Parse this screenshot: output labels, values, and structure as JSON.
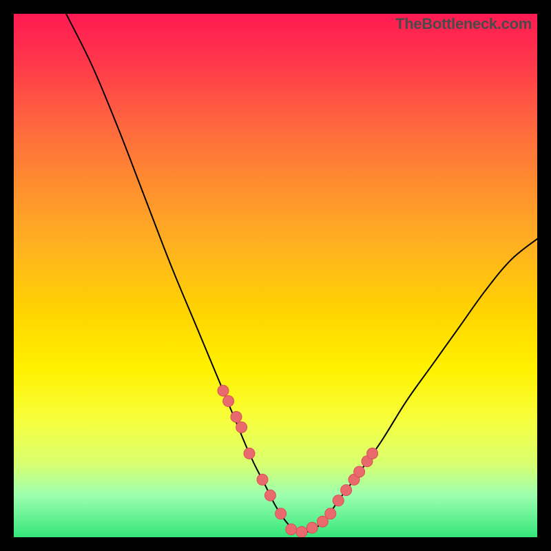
{
  "watermark": "TheBottleneck.com",
  "colors": {
    "curve": "#000000",
    "marker_fill": "#e86a6d",
    "marker_stroke": "#d95057"
  },
  "chart_data": {
    "type": "line",
    "title": "",
    "xlabel": "",
    "ylabel": "",
    "xlim": [
      0,
      100
    ],
    "ylim": [
      0,
      100
    ],
    "note": "Axes have no visible tick labels; x and y normalized 0–100. y represents bottleneck mismatch percentage (lower = better). Curve is V-shaped with minimum near x≈55.",
    "series": [
      {
        "name": "bottleneck-curve",
        "x": [
          10,
          15,
          20,
          25,
          30,
          35,
          40,
          45,
          48,
          50,
          52,
          54,
          56,
          58,
          60,
          62,
          65,
          70,
          75,
          80,
          85,
          90,
          95,
          100
        ],
        "y": [
          100,
          90,
          78,
          65,
          52,
          40,
          28,
          16,
          10,
          6,
          3,
          1,
          1,
          2,
          4,
          7,
          11,
          18,
          26,
          33,
          40,
          47,
          53,
          57
        ]
      }
    ],
    "markers": {
      "name": "highlighted-points",
      "x": [
        40,
        41,
        42.5,
        43.5,
        45,
        47.5,
        49,
        51,
        53,
        55,
        57,
        59,
        60.5,
        62,
        63.5,
        65,
        66,
        67.5,
        68.5
      ],
      "y": [
        28,
        26,
        23,
        21,
        16,
        11,
        8,
        4.5,
        1.5,
        1,
        1.8,
        3,
        4.5,
        7,
        9,
        11,
        12.5,
        14.5,
        16
      ]
    }
  }
}
